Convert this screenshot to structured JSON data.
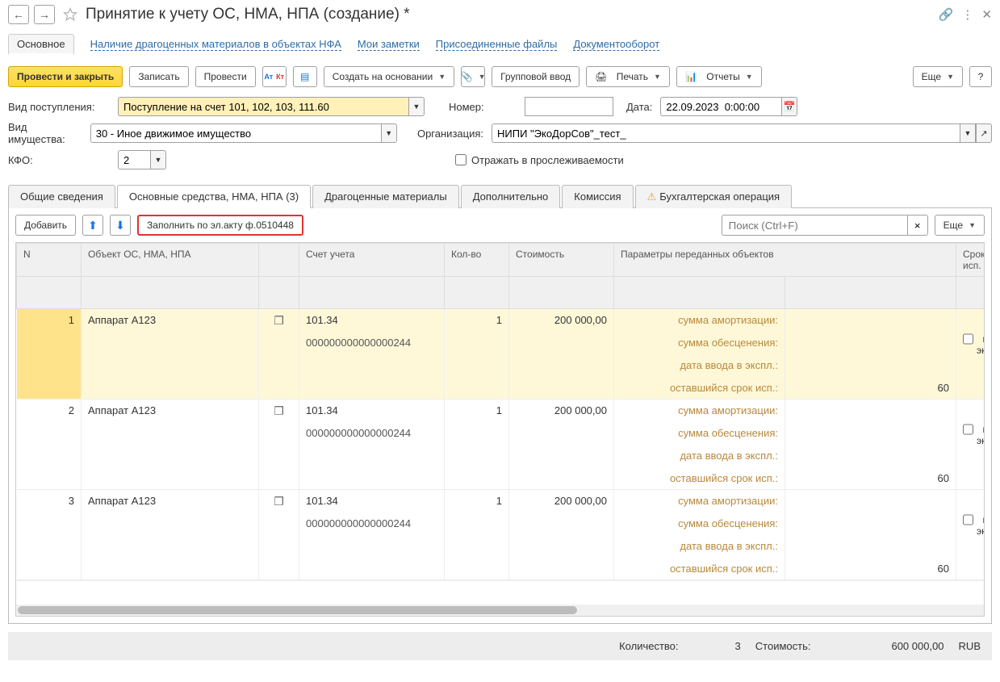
{
  "header": {
    "title": "Принятие к учету ОС, НМА, НПА (создание) *"
  },
  "topLinks": {
    "main": "Основное",
    "precious": "Наличие драгоценных материалов в объектах НФА",
    "notes": "Мои заметки",
    "files": "Присоединенные файлы",
    "workflow": "Документооборот"
  },
  "toolbar": {
    "postClose": "Провести и закрыть",
    "save": "Записать",
    "post": "Провести",
    "createBased": "Создать на основании",
    "groupInput": "Групповой ввод",
    "print": "Печать",
    "reports": "Отчеты",
    "more": "Еще",
    "help": "?"
  },
  "form": {
    "receiptTypeLabel": "Вид поступления:",
    "receiptType": "Поступление на счет 101, 102, 103, 111.60",
    "propertyTypeLabel": "Вид имущества:",
    "propertyType": "30 - Иное движимое имущество",
    "kfoLabel": "КФО:",
    "kfo": "2",
    "numberLabel": "Номер:",
    "number": "",
    "dateLabel": "Дата:",
    "date": "22.09.2023  0:00:00",
    "orgLabel": "Организация:",
    "org": "НИПИ \"ЭкоДорСов\"_тест_",
    "traceLabel": "Отражать в прослеживаемости"
  },
  "tabs": {
    "general": "Общие сведения",
    "os": "Основные средства, НМА, НПА (3)",
    "precious": "Драгоценные материалы",
    "additional": "Дополнительно",
    "commission": "Комиссия",
    "accounting": "Бухгалтерская операция"
  },
  "tabToolbar": {
    "add": "Добавить",
    "fill": "Заполнить по эл.акту ф.0510448",
    "searchPlaceholder": "Поиск (Ctrl+F)",
    "more": "Еще"
  },
  "columns": {
    "n": "N",
    "object": "Объект ОС, НМА, НПА",
    "account": "Счет учета",
    "qty": "Кол-во",
    "cost": "Стоимость",
    "params": "Параметры переданных объектов",
    "term": "Срок пол. исп."
  },
  "paramLabels": {
    "amort": "сумма амортизации:",
    "impair": "сумма обесценения:",
    "commission": "дата ввода в экспл.:",
    "remaining": "оставшийся срок исп.:"
  },
  "termAction": "ввести в эксплуатац",
  "rows": [
    {
      "n": "1",
      "object": "Аппарат А123",
      "account": "101.34",
      "subAccount": "000000000000000244",
      "qty": "1",
      "cost": "200 000,00",
      "remaining": "60"
    },
    {
      "n": "2",
      "object": "Аппарат А123",
      "account": "101.34",
      "subAccount": "000000000000000244",
      "qty": "1",
      "cost": "200 000,00",
      "remaining": "60"
    },
    {
      "n": "3",
      "object": "Аппарат А123",
      "account": "101.34",
      "subAccount": "000000000000000244",
      "qty": "1",
      "cost": "200 000,00",
      "remaining": "60"
    }
  ],
  "footer": {
    "qtyLabel": "Количество:",
    "qty": "3",
    "costLabel": "Стоимость:",
    "cost": "600 000,00",
    "currency": "RUB"
  }
}
